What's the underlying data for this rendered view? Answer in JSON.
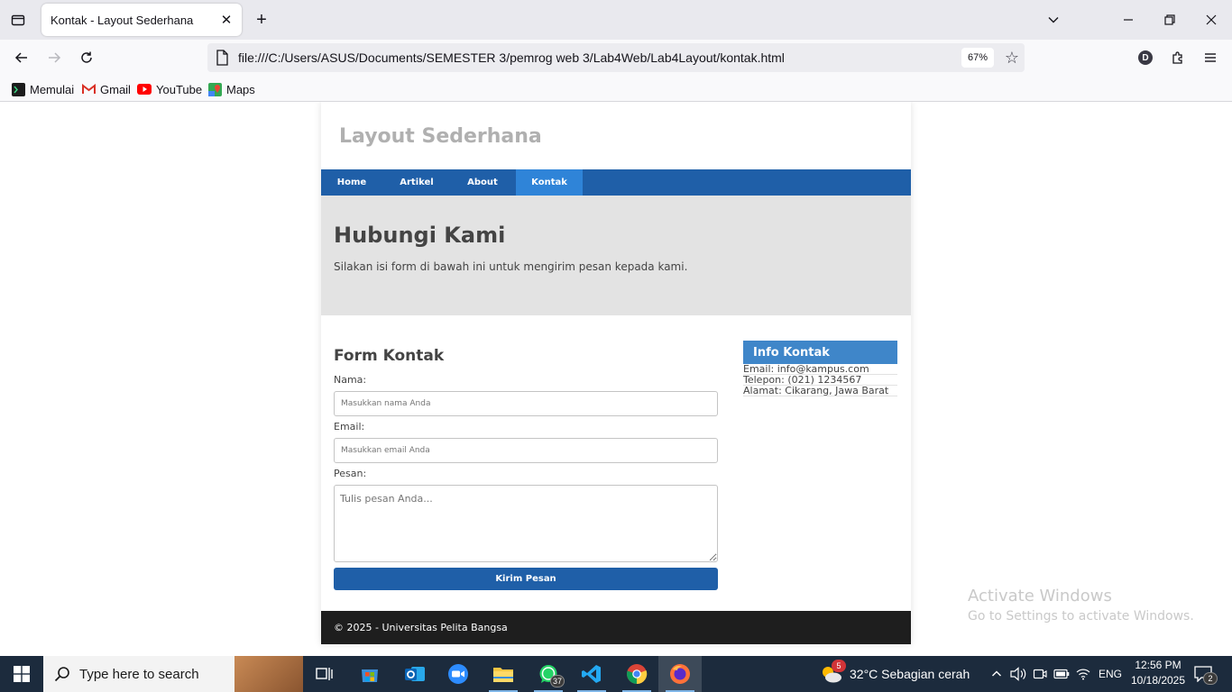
{
  "browser": {
    "tab_title": "Kontak - Layout Sederhana",
    "url": "file:///C:/Users/ASUS/Documents/SEMESTER 3/pemrog web 3/Lab4Web/Lab4Layout/kontak.html",
    "zoom": "67%",
    "profile_initial": "D",
    "bookmarks": [
      {
        "label": "Memulai",
        "icon": "terminal-icon"
      },
      {
        "label": "Gmail",
        "icon": "gmail-icon"
      },
      {
        "label": "YouTube",
        "icon": "youtube-icon"
      },
      {
        "label": "Maps",
        "icon": "maps-icon"
      }
    ]
  },
  "page": {
    "site_title": "Layout Sederhana",
    "nav": [
      {
        "label": "Home",
        "active": false
      },
      {
        "label": "Artikel",
        "active": false
      },
      {
        "label": "About",
        "active": false
      },
      {
        "label": "Kontak",
        "active": true
      }
    ],
    "hero": {
      "title": "Hubungi Kami",
      "text": "Silakan isi form di bawah ini untuk mengirim pesan kepada kami."
    },
    "form": {
      "title": "Form Kontak",
      "name_label": "Nama:",
      "name_placeholder": "Masukkan nama Anda",
      "email_label": "Email:",
      "email_placeholder": "Masukkan email Anda",
      "message_label": "Pesan:",
      "message_placeholder": "Tulis pesan Anda...",
      "submit_label": "Kirim Pesan"
    },
    "sidebar": {
      "title": "Info Kontak",
      "items": [
        "Email: info@kampus.com",
        "Telepon: (021) 1234567",
        "Alamat: Cikarang, Jawa Barat"
      ]
    },
    "footer": "© 2025 - Universitas Pelita Bangsa"
  },
  "watermark": {
    "line1": "Activate Windows",
    "line2": "Go to Settings to activate Windows."
  },
  "taskbar": {
    "search_placeholder": "Type here to search",
    "whatsapp_badge": "37",
    "weather_badge": "5",
    "weather": "32°C  Sebagian cerah",
    "language": "ENG",
    "time": "12:56 PM",
    "date": "10/18/2025",
    "notification_count": "2"
  },
  "colors": {
    "nav_blue": "#1f5fa8",
    "nav_active": "#2f84d8",
    "sidebar_head": "#3f86c9",
    "footer_bg": "#1e1e1e",
    "hero_bg": "#e3e3e3"
  }
}
